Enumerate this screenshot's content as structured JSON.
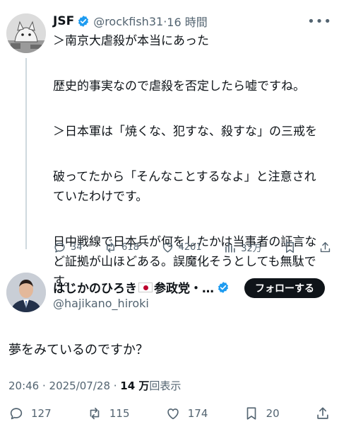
{
  "parent_tweet": {
    "display_name": "JSF",
    "handle": "@rockfish31",
    "separator": "·",
    "time": "16 時間",
    "lines": [
      "＞南京大虐殺が本当にあった",
      "歴史的事実なので虐殺を否定したら嘘ですね。",
      "＞日本軍は「焼くな、犯すな、殺すな」の三戒を",
      "破ってたから「そんなことするなよ」と注意され",
      "ていたわけです。",
      "日中戦線で日本兵が何をしたかは当事者の証言な",
      "ど証拠が山ほどある。誤魔化そうとしても無駄で",
      "す。"
    ],
    "replies": "34",
    "reposts": "618",
    "likes": "4201",
    "views": "32万"
  },
  "main_tweet": {
    "display_name_part1": "はじかのひろき",
    "display_name_part2": "参政党・…",
    "handle": "@hajikano_hiroki",
    "follow_label": "フォローする",
    "text": "夢をみているのですか？",
    "timestamp": "20:46 · 2025/07/28 · ",
    "views_count": "14 万",
    "views_label": "回表示",
    "replies": "127",
    "reposts": "115",
    "likes": "174",
    "bookmarks": "20"
  },
  "colors": {
    "text": "#0f1419",
    "secondary": "#536471",
    "verified_badge": "#1d9bf0",
    "follow_button_bg": "#0f1419"
  },
  "icons": {
    "reply": "reply-icon",
    "repost": "repost-icon",
    "like": "heart-icon",
    "views": "bar-chart-icon",
    "bookmark": "bookmark-icon",
    "share": "share-icon",
    "more": "more-icon",
    "verified": "verified-badge-icon",
    "flag": "japan-flag-icon"
  }
}
